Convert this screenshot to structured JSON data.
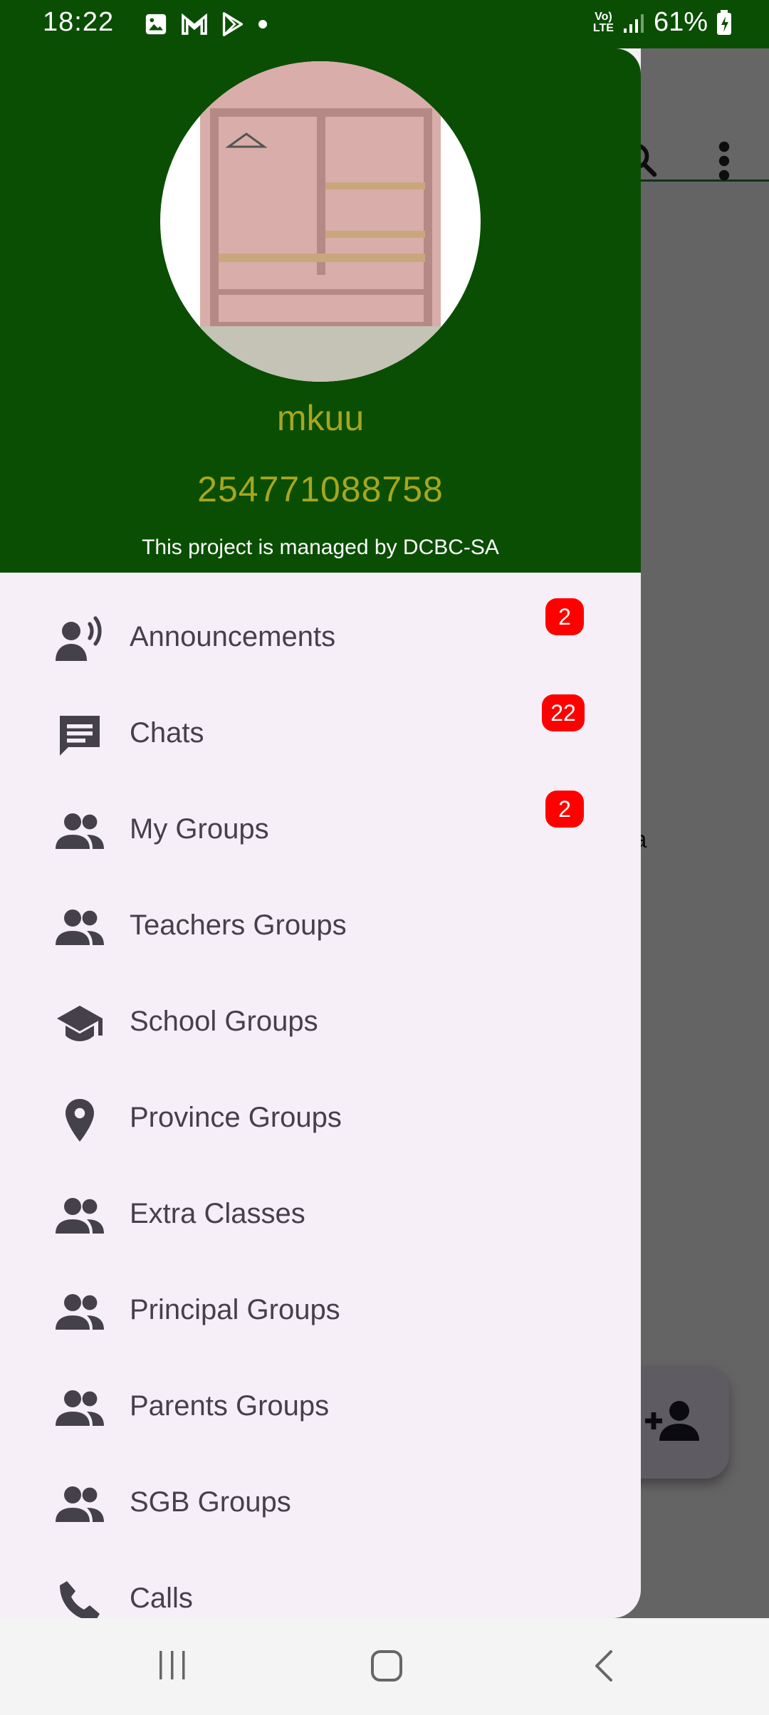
{
  "status_bar": {
    "time": "18:22",
    "network": "Vo) LTE",
    "battery": "61%"
  },
  "background": {
    "partial_text": "ta"
  },
  "drawer": {
    "profile": {
      "name": "mkuu",
      "phone": "254771088758",
      "note": "This project is managed by DCBC-SA"
    },
    "menu": [
      {
        "label": "Announcements",
        "icon": "announcement-icon",
        "badge": "2"
      },
      {
        "label": "Chats",
        "icon": "chat-icon",
        "badge": "22"
      },
      {
        "label": "My Groups",
        "icon": "group-icon",
        "badge": "2"
      },
      {
        "label": "Teachers Groups",
        "icon": "group-icon"
      },
      {
        "label": "School Groups",
        "icon": "school-icon"
      },
      {
        "label": "Province Groups",
        "icon": "location-pin-icon"
      },
      {
        "label": "Extra Classes",
        "icon": "group-icon"
      },
      {
        "label": "Principal Groups",
        "icon": "group-icon"
      },
      {
        "label": "Parents Groups",
        "icon": "group-icon"
      },
      {
        "label": "SGB Groups",
        "icon": "group-icon"
      },
      {
        "label": "Calls",
        "icon": "phone-icon"
      }
    ]
  },
  "colors": {
    "header_green": "#0a4e03",
    "profile_text": "#a7a61f",
    "badge_red": "#ff0000",
    "drawer_bg": "#f6eff7",
    "icon_gray": "#45414b"
  }
}
